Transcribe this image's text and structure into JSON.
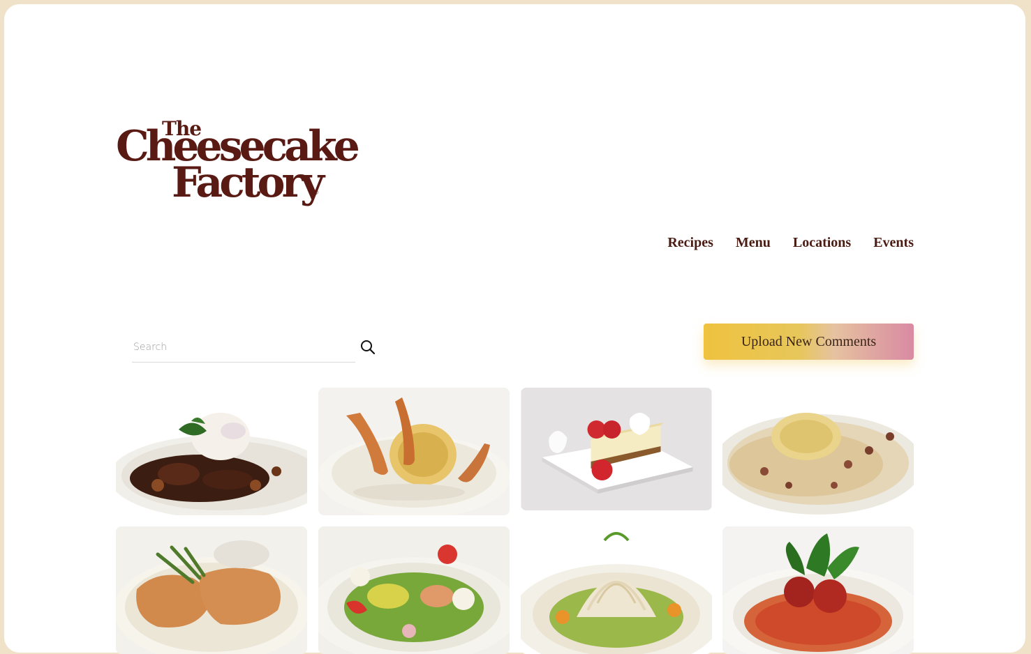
{
  "brand": {
    "logo_line1": "The",
    "logo_line2": "Cheesecake",
    "logo_line3": "Factory",
    "colors": {
      "brand_brown": "#5a1a14",
      "page_bg": "#efe2c8"
    }
  },
  "nav": {
    "items": [
      {
        "label": "Recipes"
      },
      {
        "label": "Menu"
      },
      {
        "label": "Locations"
      },
      {
        "label": "Events"
      }
    ]
  },
  "search": {
    "placeholder": "Search",
    "value": "",
    "icon": "search-icon"
  },
  "toolbar": {
    "upload_label": "Upload New Comments"
  },
  "gallery": {
    "items": [
      {
        "icon": "dish-mushroom-steak-mashed-potatoes"
      },
      {
        "icon": "dish-shrimp-angel-hair-pasta"
      },
      {
        "icon": "dish-strawberry-cheesecake-slice"
      },
      {
        "icon": "dish-pasta-carbonara"
      },
      {
        "icon": "dish-chicken-parmesan-asparagus"
      },
      {
        "icon": "dish-cobb-salad"
      },
      {
        "icon": "dish-chinese-chicken-salad"
      },
      {
        "icon": "dish-spaghetti-meatballs"
      }
    ]
  }
}
